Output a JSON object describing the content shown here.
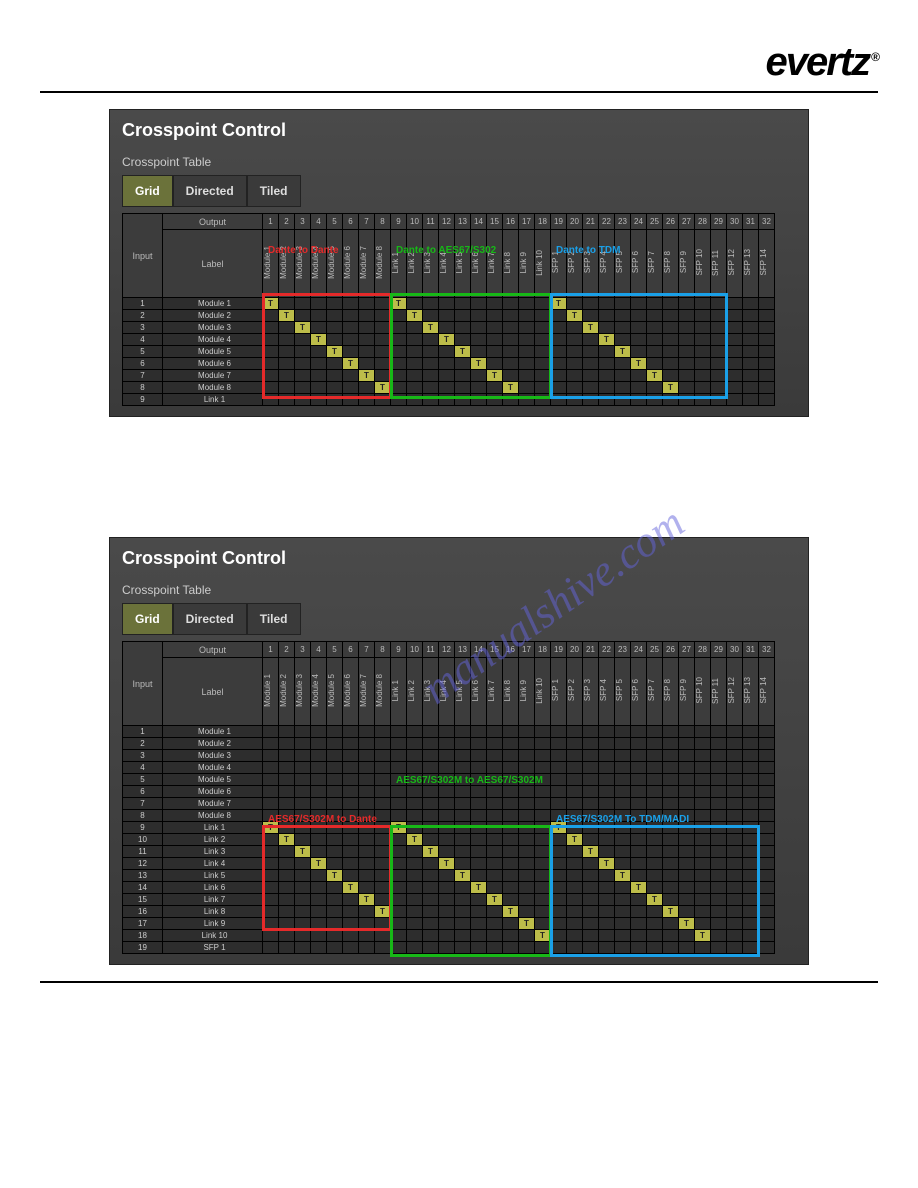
{
  "logo": "evertz",
  "logo_reg": "®",
  "watermark_text": "manualshive.com",
  "panels": [
    {
      "title": "Crosspoint Control",
      "subtitle": "Crosspoint Table",
      "tabs": [
        {
          "label": "Grid",
          "active": true
        },
        {
          "label": "Directed",
          "active": false
        },
        {
          "label": "Tiled",
          "active": false
        }
      ],
      "output_header": "Output",
      "input_header": "Input",
      "label_header": "Label",
      "col_numbers": [
        "1",
        "2",
        "3",
        "4",
        "5",
        "6",
        "7",
        "8",
        "9",
        "10",
        "11",
        "12",
        "13",
        "14",
        "15",
        "16",
        "17",
        "18",
        "19",
        "20",
        "21",
        "22",
        "23",
        "24",
        "25",
        "26",
        "27",
        "28",
        "29",
        "30",
        "31",
        "32"
      ],
      "col_labels": [
        "Module 1",
        "Module 2",
        "Module 3",
        "Module 4",
        "Module 5",
        "Module 6",
        "Module 7",
        "Module 8",
        "Link 1",
        "Link 2",
        "Link 3",
        "Link 4",
        "Link 5",
        "Link 6",
        "Link 7",
        "Link 8",
        "Link 9",
        "Link 10",
        "SFP 1",
        "SFP 2",
        "SFP 3",
        "SFP 4",
        "SFP 5",
        "SFP 6",
        "SFP 7",
        "SFP 8",
        "SFP 9",
        "SFP 10",
        "SFP 11",
        "SFP 12",
        "SFP 13",
        "SFP 14"
      ],
      "rows": [
        {
          "idx": "1",
          "label": "Module 1",
          "t": [
            0,
            8,
            18
          ]
        },
        {
          "idx": "2",
          "label": "Module 2",
          "t": [
            1,
            9,
            19
          ]
        },
        {
          "idx": "3",
          "label": "Module 3",
          "t": [
            2,
            10,
            20
          ]
        },
        {
          "idx": "4",
          "label": "Module 4",
          "t": [
            3,
            11,
            21
          ]
        },
        {
          "idx": "5",
          "label": "Module 5",
          "t": [
            4,
            12,
            22
          ]
        },
        {
          "idx": "6",
          "label": "Module 6",
          "t": [
            5,
            13,
            23
          ]
        },
        {
          "idx": "7",
          "label": "Module 7",
          "t": [
            6,
            14,
            24
          ]
        },
        {
          "idx": "8",
          "label": "Module 8",
          "t": [
            7,
            15,
            25
          ]
        },
        {
          "idx": "9",
          "label": "Link 1",
          "t": []
        }
      ],
      "regions": [
        {
          "color": "#e52a2a",
          "label": "Dante to Dante",
          "col_start": 0,
          "col_end": 7,
          "row_start": 0,
          "row_end": 7,
          "label_color": "#e52a2a"
        },
        {
          "color": "#17b817",
          "label": "Dante to AES67/S302",
          "col_start": 8,
          "col_end": 17,
          "row_start": 0,
          "row_end": 7,
          "label_color": "#17b817"
        },
        {
          "color": "#1aa0e8",
          "label": "Dante to TDM",
          "col_start": 18,
          "col_end": 28,
          "row_start": 0,
          "row_end": 7,
          "label_color": "#1aa0e8"
        }
      ]
    },
    {
      "title": "Crosspoint Control",
      "subtitle": "Crosspoint Table",
      "tabs": [
        {
          "label": "Grid",
          "active": true
        },
        {
          "label": "Directed",
          "active": false
        },
        {
          "label": "Tiled",
          "active": false
        }
      ],
      "output_header": "Output",
      "input_header": "Input",
      "label_header": "Label",
      "col_numbers": [
        "1",
        "2",
        "3",
        "4",
        "5",
        "6",
        "7",
        "8",
        "9",
        "10",
        "11",
        "12",
        "13",
        "14",
        "15",
        "16",
        "17",
        "18",
        "19",
        "20",
        "21",
        "22",
        "23",
        "24",
        "25",
        "26",
        "27",
        "28",
        "29",
        "30",
        "31",
        "32"
      ],
      "col_labels": [
        "Module 1",
        "Module 2",
        "Module 3",
        "Module 4",
        "Module 5",
        "Module 6",
        "Module 7",
        "Module 8",
        "Link 1",
        "Link 2",
        "Link 3",
        "Link 4",
        "Link 5",
        "Link 6",
        "Link 7",
        "Link 8",
        "Link 9",
        "Link 10",
        "SFP 1",
        "SFP 2",
        "SFP 3",
        "SFP 4",
        "SFP 5",
        "SFP 6",
        "SFP 7",
        "SFP 8",
        "SFP 9",
        "SFP 10",
        "SFP 11",
        "SFP 12",
        "SFP 13",
        "SFP 14"
      ],
      "rows": [
        {
          "idx": "1",
          "label": "Module 1",
          "t": []
        },
        {
          "idx": "2",
          "label": "Module 2",
          "t": []
        },
        {
          "idx": "3",
          "label": "Module 3",
          "t": []
        },
        {
          "idx": "4",
          "label": "Module 4",
          "t": []
        },
        {
          "idx": "5",
          "label": "Module 5",
          "t": []
        },
        {
          "idx": "6",
          "label": "Module 6",
          "t": []
        },
        {
          "idx": "7",
          "label": "Module 7",
          "t": []
        },
        {
          "idx": "8",
          "label": "Module 8",
          "t": []
        },
        {
          "idx": "9",
          "label": "Link 1",
          "t": [
            0,
            8,
            18
          ]
        },
        {
          "idx": "10",
          "label": "Link 2",
          "t": [
            1,
            9,
            19
          ]
        },
        {
          "idx": "11",
          "label": "Link 3",
          "t": [
            2,
            10,
            20
          ]
        },
        {
          "idx": "12",
          "label": "Link 4",
          "t": [
            3,
            11,
            21
          ]
        },
        {
          "idx": "13",
          "label": "Link 5",
          "t": [
            4,
            12,
            22
          ]
        },
        {
          "idx": "14",
          "label": "Link 6",
          "t": [
            5,
            13,
            23
          ]
        },
        {
          "idx": "15",
          "label": "Link 7",
          "t": [
            6,
            14,
            24
          ]
        },
        {
          "idx": "16",
          "label": "Link 8",
          "t": [
            7,
            15,
            25
          ]
        },
        {
          "idx": "17",
          "label": "Link 9",
          "t": [
            16,
            26
          ]
        },
        {
          "idx": "18",
          "label": "Link 10",
          "t": [
            17,
            27
          ]
        },
        {
          "idx": "19",
          "label": "SFP 1",
          "t": []
        }
      ],
      "regions": [
        {
          "color": "#e52a2a",
          "label": "AES67/S302M to Dante",
          "col_start": 0,
          "col_end": 7,
          "row_start": 8,
          "row_end": 15,
          "label_color": "#e52a2a",
          "label_row": 7
        },
        {
          "color": "#17b817",
          "label": "AES67/S302M to AES67/S302M",
          "col_start": 8,
          "col_end": 17,
          "row_start": 8,
          "row_end": 17,
          "label_color": "#17b817",
          "label_row": 4
        },
        {
          "color": "#1aa0e8",
          "label": "AES67/S302M To TDM/MADI",
          "col_start": 18,
          "col_end": 30,
          "row_start": 8,
          "row_end": 17,
          "label_color": "#1aa0e8",
          "label_row": 7
        }
      ]
    }
  ]
}
